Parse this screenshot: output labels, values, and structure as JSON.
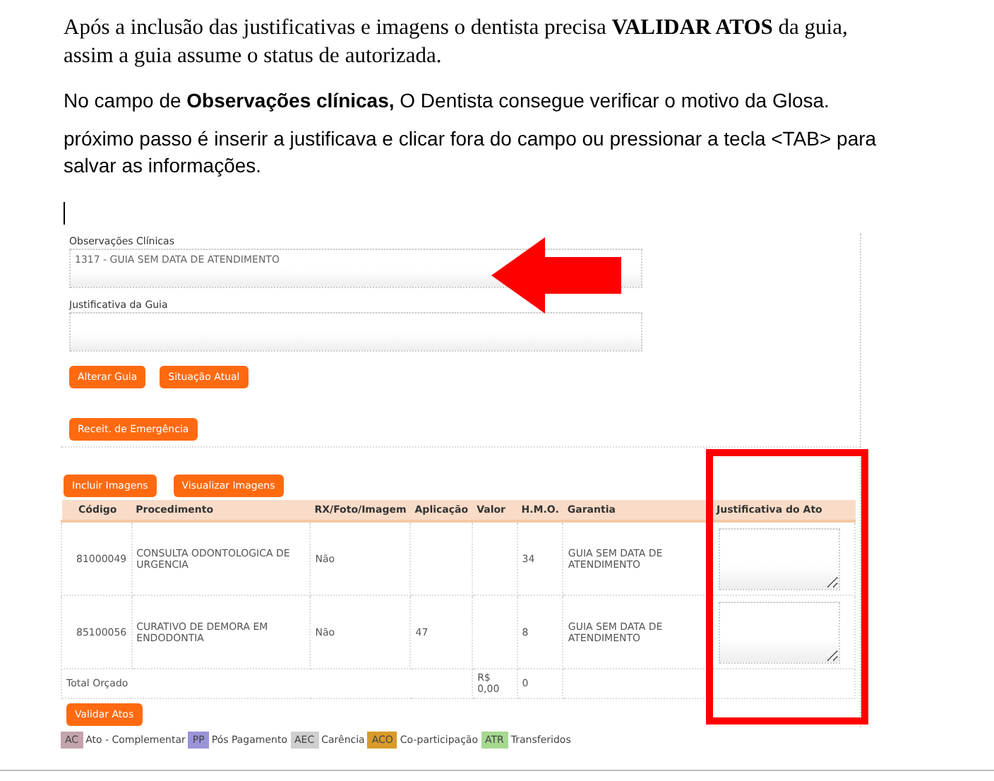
{
  "document": {
    "paragraphs": [
      {
        "kind": "serif",
        "text": "Após a inclusão das justificativas e imagens o dentista precisa **VALIDAR ATOS** da guia, assim a guia assume o status de autorizada."
      },
      {
        "kind": "sans",
        "text": "No campo de **Observações clínicas,** O Dentista consegue verificar o motivo da Glosa."
      },
      {
        "kind": "sans",
        "text": "próximo passo é inserir a justificava e clicar fora do campo ou pressionar a tecla <TAB> para salvar as informações."
      }
    ]
  },
  "form": {
    "fields": [
      {
        "label": "Observações Clínicas",
        "value": "1317 - GUIA SEM DATA DE ATENDIMENTO"
      },
      {
        "label": "Justificativa da Guia"
      }
    ],
    "guide_buttons": [
      "Alterar Guia",
      "Situação Atual"
    ],
    "emergency_button": "Receit. de Emergência",
    "image_buttons": [
      "Incluir Imagens",
      "Visualizar Imagens"
    ],
    "table": {
      "columns": [
        "Código",
        "Procedimento",
        "RX/Foto/Imagem",
        "Aplicação",
        "Valor",
        "H.M.O.",
        "Garantia",
        "Justificativa do Ato"
      ],
      "rows": [
        {
          "codigo": "81000049",
          "procedimento": "CONSULTA ODONTOLOGICA DE URGENCIA",
          "rx": "Não",
          "hmo": "34",
          "garantia": "GUIA SEM DATA DE ATENDIMENTO"
        },
        {
          "codigo": "85100056",
          "procedimento": "CURATIVO DE DEMORA EM ENDODONTIA",
          "rx": "Não",
          "aplicacao": "47",
          "hmo": "8",
          "garantia": "GUIA SEM DATA DE ATENDIMENTO"
        }
      ],
      "total": {
        "label": "Total Orçado",
        "valor": "R$ 0,00",
        "hmo": "0"
      }
    },
    "validate_button": "Validar Atos",
    "legend": [
      {
        "code": "AC",
        "label": "Ato - Complementar",
        "color": "#c4a4ac"
      },
      {
        "code": "PP",
        "label": "Pós Pagamento",
        "color": "#9a94d8"
      },
      {
        "code": "AEC",
        "label": "Carência",
        "color": "#cfcfcf"
      },
      {
        "code": "ACO",
        "label": "Co-participação",
        "color": "#d89a2a"
      },
      {
        "code": "ATR",
        "label": "Transferidos",
        "color": "#a6d890"
      }
    ]
  }
}
